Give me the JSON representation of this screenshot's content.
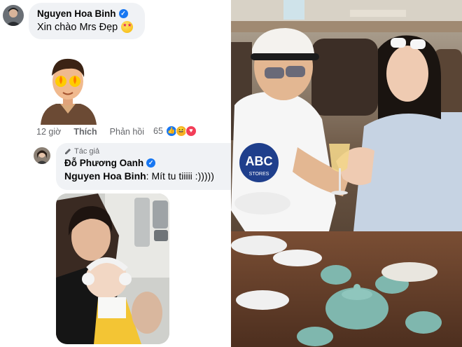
{
  "comment1": {
    "author": "Nguyen Hoa Binh",
    "text": "Xin chào Mrs Đẹp",
    "emoji_icon": "star-struck-emoji-icon"
  },
  "comment_actions": {
    "time": "12 giờ",
    "like": "Thích",
    "reply": "Phản hồi",
    "reaction_count": "65",
    "reaction_icons": [
      "like-reaction-icon",
      "haha-reaction-icon",
      "love-reaction-icon"
    ]
  },
  "reply1": {
    "author_badge": "Tác giả",
    "author": "Đỗ Phương Oanh",
    "mention": "Nguyen Hoa Binh",
    "text": ": Mít tu tiiiii :)))))"
  },
  "sign": {
    "text": "ABC",
    "subtext": "STORES"
  },
  "colors": {
    "accent": "#1877f2",
    "bubble_bg": "#f0f2f5",
    "meta_text": "#65676b"
  }
}
